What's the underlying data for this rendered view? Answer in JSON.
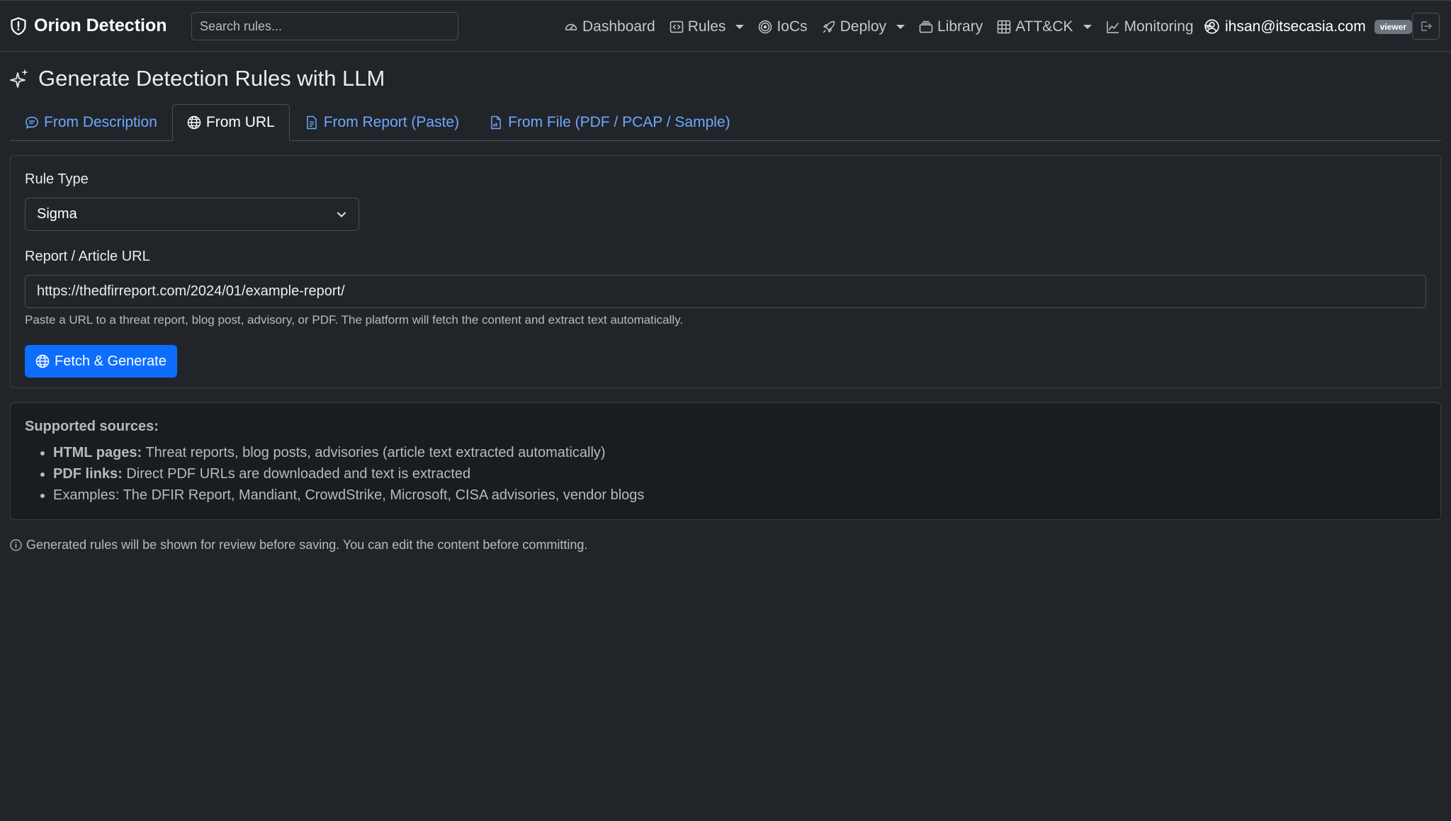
{
  "navbar": {
    "brand": "Orion Detection",
    "search_placeholder": "Search rules...",
    "items": [
      {
        "label": "Dashboard",
        "icon": "speedometer-icon",
        "dropdown": false
      },
      {
        "label": "Rules",
        "icon": "code-icon",
        "dropdown": true
      },
      {
        "label": "IoCs",
        "icon": "bullseye-icon",
        "dropdown": false
      },
      {
        "label": "Deploy",
        "icon": "rocket-icon",
        "dropdown": true
      },
      {
        "label": "Library",
        "icon": "collection-icon",
        "dropdown": false
      },
      {
        "label": "ATT&CK",
        "icon": "grid-icon",
        "dropdown": true
      },
      {
        "label": "Monitoring",
        "icon": "chart-line-icon",
        "dropdown": true
      }
    ],
    "user_email": "ihsan@itsecasia.com",
    "role_badge": "viewer"
  },
  "page": {
    "title": "Generate Detection Rules with LLM"
  },
  "tabs": [
    {
      "label": "From Description",
      "active": false
    },
    {
      "label": "From URL",
      "active": true
    },
    {
      "label": "From Report (Paste)",
      "active": false
    },
    {
      "label": "From File (PDF / PCAP / Sample)",
      "active": false
    }
  ],
  "form": {
    "rule_type_label": "Rule Type",
    "rule_type_value": "Sigma",
    "url_label": "Report / Article URL",
    "url_value": "https://thedfirreport.com/2024/01/example-report/",
    "url_help": "Paste a URL to a threat report, blog post, advisory, or PDF. The platform will fetch the content and extract text automatically.",
    "submit_label": "Fetch & Generate"
  },
  "sources": {
    "title": "Supported sources:",
    "items": [
      {
        "bold": "HTML pages:",
        "text": " Threat reports, blog posts, advisories (article text extracted automatically)"
      },
      {
        "bold": "PDF links:",
        "text": " Direct PDF URLs are downloaded and text is extracted"
      },
      {
        "bold": "",
        "text": "Examples: The DFIR Report, Mandiant, CrowdStrike, Microsoft, CISA advisories, vendor blogs"
      }
    ]
  },
  "footnote": "Generated rules will be shown for review before saving. You can edit the content before committing.",
  "colors": {
    "background": "#212529",
    "primary": "#0d6efd",
    "link": "#6ea8fe",
    "badge": "#6c757d"
  }
}
